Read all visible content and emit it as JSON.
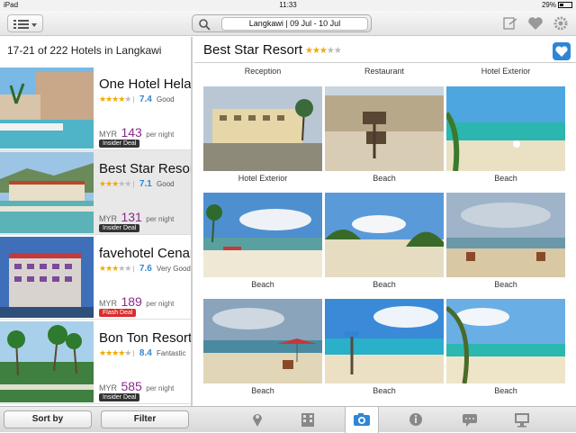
{
  "status_bar": {
    "device": "iPad",
    "time": "11:33",
    "battery": "29%"
  },
  "navbar": {
    "search_value": "Langkawi | 09 Jul - 10 Jul",
    "icons": [
      "menu-icon",
      "search-icon",
      "compare-icon",
      "heart-icon",
      "settings-icon"
    ]
  },
  "results": {
    "count_text": "17-21 of 222 Hotels in Langkawi",
    "hotels": [
      {
        "name": "One Hotel Helang",
        "stars": 4,
        "score": "7.4",
        "score_text": "Good",
        "currency": "MYR",
        "price": "143",
        "per": "per night",
        "deal": "Insider Deal",
        "deal_type": "insider"
      },
      {
        "name": "Best Star Resort",
        "stars": 3,
        "score": "7.1",
        "score_text": "Good",
        "currency": "MYR",
        "price": "131",
        "per": "per night",
        "deal": "Insider Deal",
        "deal_type": "insider"
      },
      {
        "name": "favehotel Cenang",
        "stars": 3,
        "score": "7.6",
        "score_text": "Very Good",
        "currency": "MYR",
        "price": "189",
        "per": "per night",
        "deal": "Flash Deal",
        "deal_type": "flash"
      },
      {
        "name": "Bon Ton Resort",
        "stars": 4,
        "score": "8.4",
        "score_text": "Fantastic",
        "currency": "MYR",
        "price": "585",
        "per": "per night",
        "deal": "Insider Deal",
        "deal_type": "insider"
      }
    ]
  },
  "detail": {
    "hotel_name": "Best Star Resort",
    "stars": 3,
    "top_captions": [
      "Reception",
      "Restaurant",
      "Hotel Exterior"
    ],
    "photos": [
      {
        "caption": "Hotel Exterior"
      },
      {
        "caption": "Beach"
      },
      {
        "caption": "Beach"
      },
      {
        "caption": "Beach"
      },
      {
        "caption": "Beach"
      },
      {
        "caption": "Beach"
      },
      {
        "caption": "Beach"
      },
      {
        "caption": "Beach"
      },
      {
        "caption": "Beach"
      }
    ]
  },
  "bottom_bar": {
    "sort_label": "Sort by",
    "filter_label": "Filter",
    "tabs": [
      "map-pin-icon",
      "building-icon",
      "camera-icon",
      "info-icon",
      "reviews-icon",
      "monitor-icon"
    ],
    "active_tab": "camera-icon"
  },
  "colors": {
    "accent": "#2f86d6",
    "price": "#8a2a8a",
    "star": "#f2a900",
    "flash": "#d92d2d"
  }
}
